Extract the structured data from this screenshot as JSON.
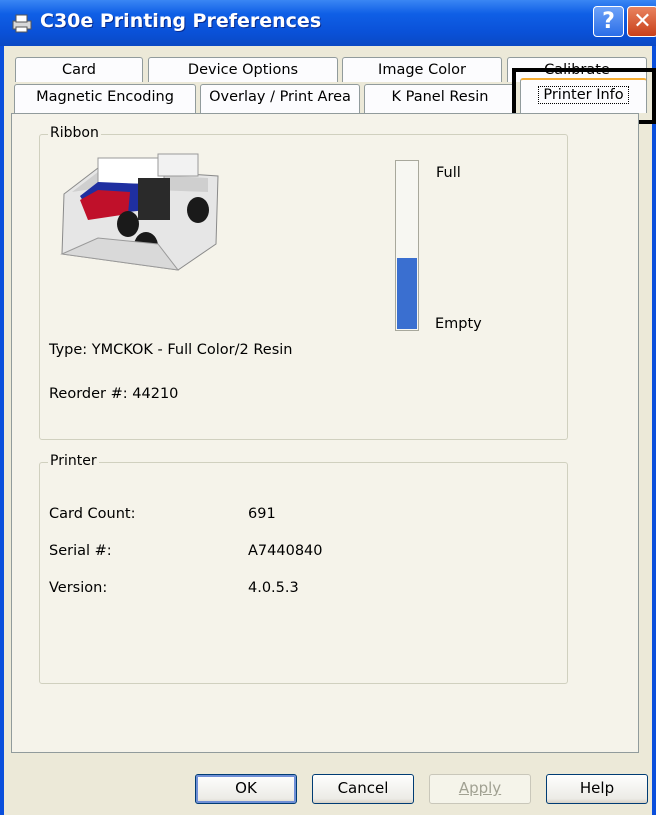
{
  "window": {
    "title": "C30e Printing Preferences",
    "help_glyph": "?",
    "close_glyph": "✕"
  },
  "tabs": {
    "row1": [
      "Card",
      "Device Options",
      "Image Color",
      "Calibrate"
    ],
    "row2": [
      "Magnetic Encoding",
      "Overlay / Print Area",
      "K Panel Resin",
      "Printer Info"
    ],
    "active": "Printer Info"
  },
  "ribbon": {
    "group_label": "Ribbon",
    "level_full_label": "Full",
    "level_empty_label": "Empty",
    "level_fraction": 0.42,
    "type_text": "Type: YMCKOK - Full Color/2 Resin",
    "reorder_text": "Reorder #: 44210"
  },
  "printer": {
    "group_label": "Printer",
    "rows": [
      {
        "label": "Card Count:",
        "value": "691"
      },
      {
        "label": "Serial #:",
        "value": "A7440840"
      },
      {
        "label": "Version:",
        "value": "4.0.5.3"
      }
    ]
  },
  "buttons": {
    "ok": "OK",
    "cancel": "Cancel",
    "apply": "Apply",
    "help": "Help"
  },
  "colors": {
    "titlebar": "#0a51d8",
    "dialog_bg": "#ece9d8",
    "ribbon_level": "#3a6fd0"
  },
  "icons": {
    "title_icon": "printer-icon"
  }
}
